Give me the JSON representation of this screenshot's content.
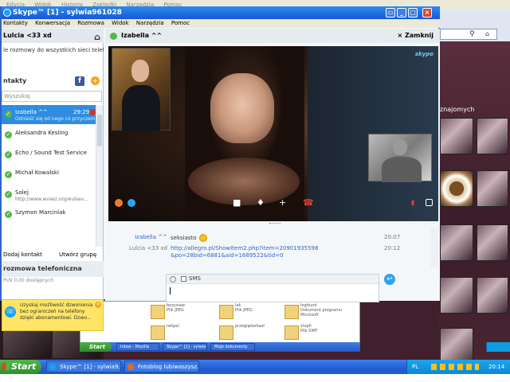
{
  "browser": {
    "menu": [
      "Edycja",
      "Widok",
      "Historia",
      "Zakładki",
      "Narzędzia",
      "Pomoc"
    ],
    "side_heading": "znajomych"
  },
  "skype": {
    "title": "Skype™ [1] - sylwia961028",
    "menu": [
      "Kontakty",
      "Konwersacja",
      "Rozmowa",
      "Widok",
      "Narzędzia",
      "Pomoc"
    ],
    "profile_name": "Lulcia <33 xd",
    "info_text": "le rozmowy do wszystkich sieci telefoni...",
    "contacts_heading": "ntakty",
    "search_placeholder": "Wyszukaj",
    "contacts": [
      {
        "name": "Izabella ^^",
        "sub": "Odnieść się od nego co przyczem...",
        "time": "29:29",
        "selected": true
      },
      {
        "name": "Aleksandra Kesling",
        "sub": "",
        "time": "",
        "selected": false
      },
      {
        "name": "Echo / Sound Test Service",
        "sub": "",
        "time": "",
        "selected": false
      },
      {
        "name": "Michał Kowalski",
        "sub": "",
        "time": "",
        "selected": false
      },
      {
        "name": "Solej",
        "sub": "http://www.wvsez.org/eulsev...",
        "time": "",
        "selected": false
      },
      {
        "name": "Szymon Marciniak",
        "sub": "",
        "time": "",
        "selected": false
      }
    ],
    "add_contact": "Dodaj kontakt",
    "create_group": "Utwórz grupę",
    "call_section": "rozmowa telefoniczna",
    "credit": "PLN 0,00 dostępnych",
    "promo": "Uzyskaj możliwość dzwonienia bez ograniczeń na telefony dzięki abonamentowi. Dzwo..."
  },
  "conversation": {
    "contact_name": "Izabella ^^",
    "close_label": "Zamknij",
    "skype_watermark": "skype",
    "messages": [
      {
        "sender": "Izabella ^^",
        "text": "seksiasto",
        "time": "20:07"
      },
      {
        "sender": "Lulcia <33 xd",
        "text": "http://allegro.pl/ShowItem2.php?item=20901935598&po=28bid=6881&aid=1689522&tid=0",
        "time": "20:12"
      }
    ],
    "sms_label": "SMS"
  },
  "files": [
    {
      "name": "bozysiaw",
      "info": "Plik JPEG"
    },
    {
      "name": "lak",
      "info": "Plik JPEG"
    },
    {
      "name": "logfount",
      "info": "Dokument programu Microsoft"
    },
    {
      "name": "netpol",
      "info": ""
    },
    {
      "name": "przeglądarkasł",
      "info": ""
    },
    {
      "name": "stopll",
      "info": ""
    },
    {
      "name": "utwór",
      "info": "Plik SWF"
    }
  ],
  "inner_taskbar": {
    "start": "Start",
    "tasks": [
      "Inbox - Mozilla",
      "Skype™ [1] - sylwia",
      "Moje dokumenty"
    ]
  },
  "taskbar": {
    "start_label": "Start",
    "tasks": [
      "Skype™ [1] - sylwia9...",
      "Fotoblog lubiwaszysz..."
    ],
    "language": "PL",
    "clock": "20:14"
  }
}
